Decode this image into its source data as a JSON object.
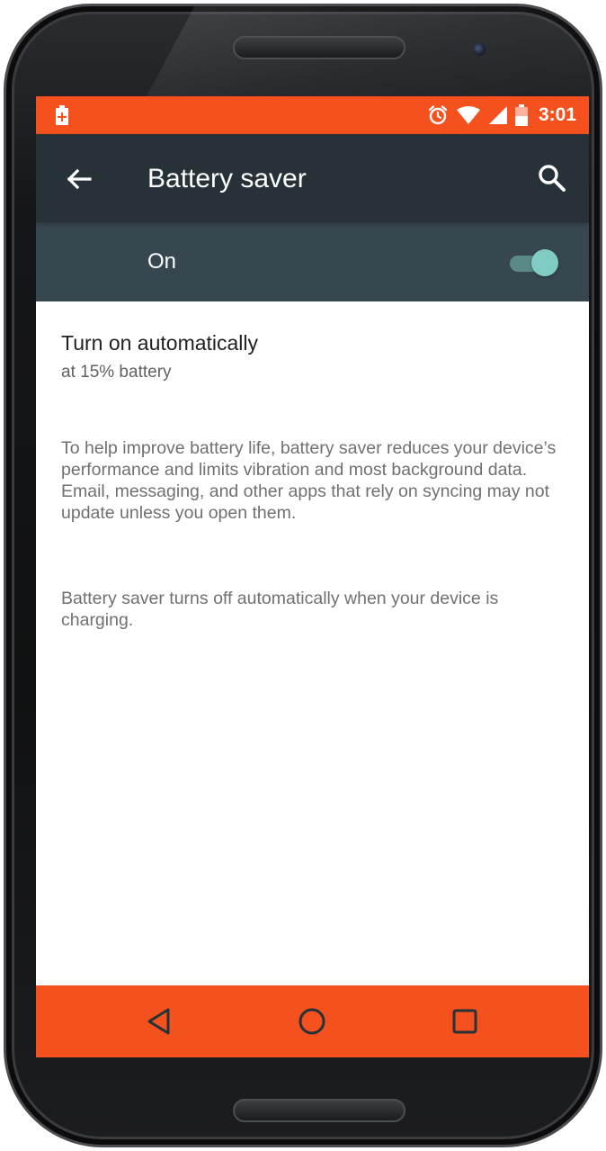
{
  "status_bar": {
    "time": "3:01",
    "icons": [
      "battery-saver-notification-icon",
      "alarm-icon",
      "wifi-icon",
      "cellular-signal-icon",
      "battery-icon"
    ],
    "color": "#f4511e"
  },
  "app_bar": {
    "title": "Battery saver",
    "back_icon": "arrow-left-icon",
    "search_icon": "search-icon",
    "color": "#263238"
  },
  "master_switch": {
    "label": "On",
    "checked": true,
    "color": "#37474f",
    "accent": "#80cbc4"
  },
  "settings": {
    "auto": {
      "title": "Turn on automatically",
      "summary": "at 15% battery"
    },
    "description_1": "To help improve battery life, battery saver reduces your device’s performance and limits vibration and most background data. Email, messaging, and other apps that rely on syncing may not update unless you open them.",
    "description_2": "Battery saver turns off automatically when your device is charging."
  },
  "nav_bar": {
    "buttons": [
      "back-triangle-icon",
      "home-circle-icon",
      "recents-square-icon"
    ],
    "color": "#f4511e"
  }
}
